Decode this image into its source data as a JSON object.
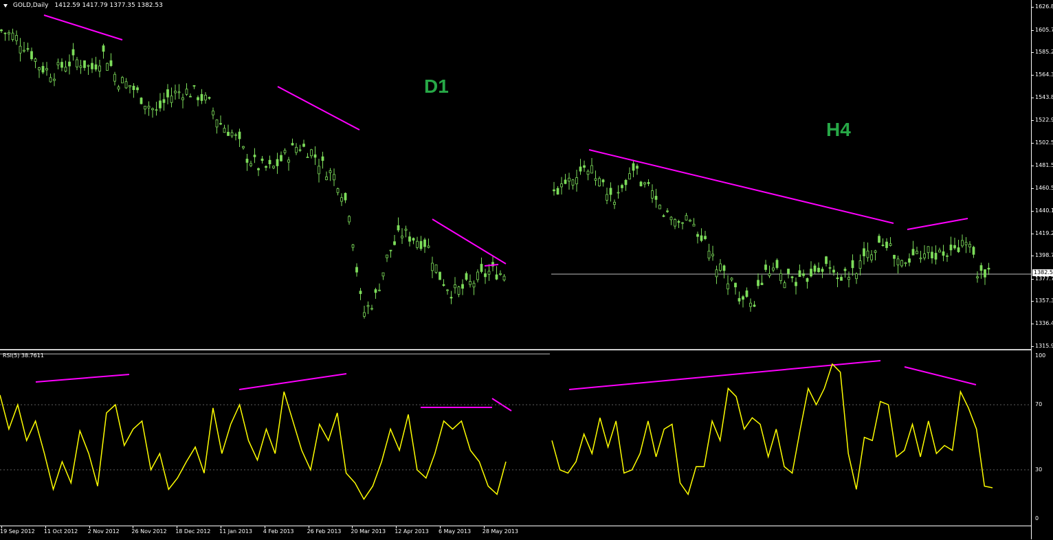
{
  "header": {
    "symbol": "GOLD,Daily",
    "ohlc": "1412.59 1417.79 1377.35 1382.53"
  },
  "labels": {
    "left_timeframe": "D1",
    "right_timeframe": "H4"
  },
  "price_axis": {
    "ticks": [
      "1626.8",
      "1605.7",
      "1585.2",
      "1564.3",
      "1543.8",
      "1522.9",
      "1502.5",
      "1481.5",
      "1460.5",
      "1440.1",
      "1419.2",
      "1398.7",
      "1377.7",
      "1357.3",
      "1336.4",
      "1315.9"
    ],
    "current_price": "1382.5"
  },
  "rsi": {
    "label": "RSI(5) 38.7611",
    "ticks": [
      "100",
      "70",
      "30",
      "0"
    ],
    "overbought": 70,
    "oversold": 30
  },
  "date_axis": {
    "labels": [
      "19 Sep 2012",
      "11 Oct 2012",
      "2 Nov 2012",
      "26 Nov 2012",
      "18 Dec 2012",
      "11 Jan 2013",
      "4 Feb 2013",
      "26 Feb 2013",
      "20 Mar 2013",
      "12 Apr 2013",
      "6 May 2013",
      "28 May 2013"
    ]
  },
  "colors": {
    "candles": "#7cdc5a",
    "rsi_line": "#ffff00",
    "trendline": "#ff00ff",
    "label_green": "#27a847"
  },
  "chart_data": [
    {
      "type": "line",
      "title": "GOLD,Daily",
      "xlabel": "",
      "ylabel": "",
      "ylim": [
        1315.9,
        1626.8
      ],
      "x": [
        "19 Sep 2012",
        "11 Oct 2012",
        "2 Nov 2012",
        "26 Nov 2012",
        "18 Dec 2012",
        "11 Jan 2013",
        "4 Feb 2013",
        "26 Feb 2013",
        "20 Mar 2013",
        "12 Apr 2013",
        "6 May 2013",
        "28 May 2013"
      ],
      "series": [
        {
          "values": [
            1605,
            1600,
            1590,
            1572,
            1566,
            1575,
            1578,
            1570,
            1585,
            1560,
            1555,
            1542,
            1530,
            1545,
            1550,
            1548,
            1540,
            1520,
            1510,
            1490,
            1480,
            1478,
            1490,
            1500,
            1495,
            1480,
            1470,
            1440,
            1345,
            1360,
            1400,
            1420,
            1415,
            1410,
            1380,
            1365,
            1370,
            1378,
            1385,
            1382
          ]
        }
      ]
    },
    {
      "type": "line",
      "title": "",
      "ylim": [
        1315.9,
        1626.8
      ],
      "series": [
        {
          "values": [
            1455,
            1470,
            1475,
            1480,
            1472,
            1460,
            1448,
            1465,
            1475,
            1460,
            1445,
            1435,
            1430,
            1435,
            1420,
            1400,
            1385,
            1378,
            1362,
            1350,
            1375,
            1385,
            1378,
            1380,
            1372,
            1388,
            1390,
            1384,
            1378,
            1385,
            1395,
            1410,
            1415,
            1395,
            1390,
            1402,
            1405,
            1398,
            1400,
            1405,
            1415,
            1380,
            1380
          ]
        }
      ]
    },
    {
      "type": "line",
      "title": "RSI(5) 38.7611",
      "ylim": [
        0,
        100
      ],
      "series": [
        {
          "values": [
            76,
            55,
            70,
            48,
            60,
            40,
            18,
            35,
            22,
            54,
            40,
            20,
            65,
            70,
            45,
            55,
            60,
            30,
            40,
            18,
            25,
            35,
            44,
            28,
            68,
            40,
            58,
            70,
            48,
            36,
            55,
            40,
            78,
            60,
            42,
            30,
            58,
            48,
            65,
            28,
            22,
            12,
            20,
            35,
            55,
            42,
            64,
            30,
            25,
            40,
            60,
            55,
            60,
            42,
            35,
            20,
            15,
            35,
            48,
            30,
            28,
            35,
            52,
            40,
            62,
            44,
            60,
            28,
            30,
            40,
            60,
            38,
            55,
            58,
            22,
            15,
            32,
            32,
            60,
            48,
            80,
            75,
            55,
            62,
            58,
            38,
            55,
            32,
            28,
            55,
            80,
            70,
            80,
            95,
            90,
            40,
            18,
            50,
            48,
            72,
            70,
            38,
            42,
            58,
            38,
            60,
            40,
            45,
            42,
            78,
            68,
            55,
            20,
            19
          ]
        }
      ]
    }
  ]
}
